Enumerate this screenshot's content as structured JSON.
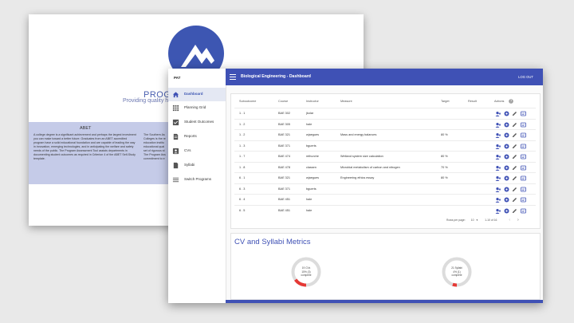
{
  "landing": {
    "title": "PROGR",
    "subtitle": "Providing quality high",
    "abet_heading": "ABET",
    "abet_text": "A college degree is a significant achievement and perhaps the largest investment you can make toward a better future. Graduates from an ABET accredited program have a solid educational foundation and are capable of leading the way in innovation, emerging technologies, and in anticipating the welfare and safety needs of the public. The Program Assessment Tool assists departments in documenting student outcomes as required in Criterion 4 of the ABET Self-Study template.",
    "abet_text2": "The Southern As Colleges is the re education institu educational qual set of rigorous st The Program Ass commitment to e"
  },
  "sidebar": {
    "brand": "PAT",
    "items": [
      {
        "label": "Dashboard",
        "icon": "home-icon"
      },
      {
        "label": "Planning Grid",
        "icon": "grid-icon"
      },
      {
        "label": "Student Outcomes",
        "icon": "checkbox-icon"
      },
      {
        "label": "Reports",
        "icon": "document-icon"
      },
      {
        "label": "CVs",
        "icon": "person-icon"
      },
      {
        "label": "Syllabi",
        "icon": "file-icon"
      },
      {
        "label": "Switch Programs",
        "icon": "list-icon"
      }
    ]
  },
  "topbar": {
    "title": "Biological Engineering - Dashboard",
    "logout": "LOG OUT"
  },
  "table": {
    "headers": [
      "Suboutcome",
      "Course",
      "Instructor",
      "Measure",
      "Target",
      "Result",
      "Actions"
    ],
    "rows": [
      [
        "1 . 1",
        "BAE 302",
        "jkolar",
        "",
        ""
      ],
      [
        "1 . 2",
        "BAE 305",
        "hale",
        "",
        ""
      ],
      [
        "1 . 2",
        "BAE 321",
        "wjaegues",
        "Mass and energy balances",
        "80 %"
      ],
      [
        "1 . 3",
        "BAE 371",
        "bguerts",
        "",
        ""
      ],
      [
        "1 . 7",
        "BAE 474",
        "mthurche",
        "Wetland system size calculation",
        "80 %"
      ],
      [
        "1 . 8",
        "BAE 478",
        "classen",
        "Microbial metabolism of carbon and nitrogen",
        "70 %"
      ],
      [
        "6 . 1",
        "BAE 321",
        "wjaegues",
        "Engineering ethics essay",
        "80 %"
      ],
      [
        "6 . 3",
        "BAE 371",
        "bguerts",
        "",
        ""
      ],
      [
        "6 . 4",
        "BAE 451",
        "hale",
        "",
        ""
      ],
      [
        "6 . 5",
        "BAE 451",
        "hale",
        "",
        ""
      ]
    ],
    "rows_per_page_label": "Rows per page:",
    "rows_per_page_value": "10",
    "range": "1-10 of 16"
  },
  "metrics": {
    "title": "CV and Syllabi Metrics",
    "gauges": [
      {
        "line1": "19 CVs",
        "line2": "15% (3)",
        "line3": "complete",
        "value": 0.15
      },
      {
        "line1": "21 Syllabi",
        "line2": "4% (1)",
        "line3": "complete",
        "value": 0.05
      }
    ]
  },
  "colors": {
    "primary": "#3f51b5",
    "gauge_fill": "#e53935",
    "gauge_track": "#dcdcdc"
  }
}
